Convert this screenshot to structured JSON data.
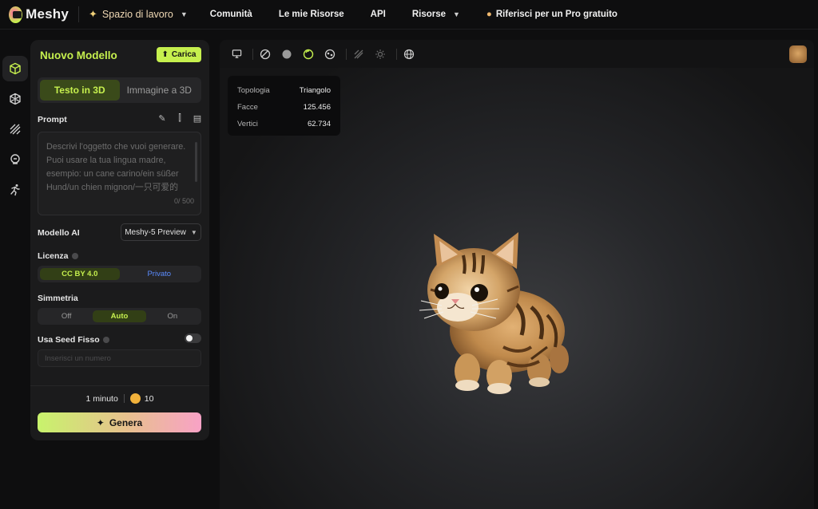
{
  "topbar": {
    "logo_text": "Meshy",
    "workspace_label": "Spazio di lavoro",
    "nav": [
      {
        "label": "Comunità"
      },
      {
        "label": "Le mie Risorse"
      },
      {
        "label": "API"
      },
      {
        "label": "Risorse"
      },
      {
        "label": "Riferisci per un Pro gratuito"
      }
    ]
  },
  "rail": {
    "items": [
      {
        "name": "model-icon",
        "active": true
      },
      {
        "name": "texture-icon"
      },
      {
        "name": "remesh-icon"
      },
      {
        "name": "rig-icon"
      },
      {
        "name": "animate-icon"
      }
    ]
  },
  "panel": {
    "title": "Nuovo Modello",
    "upload_label": "Carica",
    "mode_tabs": [
      "Testo in 3D",
      "Immagine a 3D"
    ],
    "prompt_label": "Prompt",
    "prompt_placeholder": "Descrivi l'oggetto che vuoi generare. Puoi usare la tua lingua madre, esempio: un cane carino/ein süßer Hund/un chien mignon/一只可爱的",
    "prompt_count": "0/ 500",
    "ai_model_label": "Modello AI",
    "ai_model_value": "Meshy-5 Preview",
    "license_label": "Licenza",
    "license_options": [
      "CC BY 4.0",
      "Privato"
    ],
    "symmetry_label": "Simmetria",
    "symmetry_options": [
      "Off",
      "Auto",
      "On"
    ],
    "seed_label": "Usa Seed Fisso",
    "seed_placeholder": "Inserisci un numero",
    "time_label": "1 minuto",
    "credits": "10",
    "generate_label": "Genera"
  },
  "viewer": {
    "stats": [
      {
        "key": "Topologia",
        "value": "Triangolo"
      },
      {
        "key": "Facce",
        "value": "125.456"
      },
      {
        "key": "Vertici",
        "value": "62.734"
      }
    ]
  },
  "colors": {
    "accent": "#c6f04e",
    "private_link": "#5b8cff",
    "coin": "#f2b23b"
  }
}
